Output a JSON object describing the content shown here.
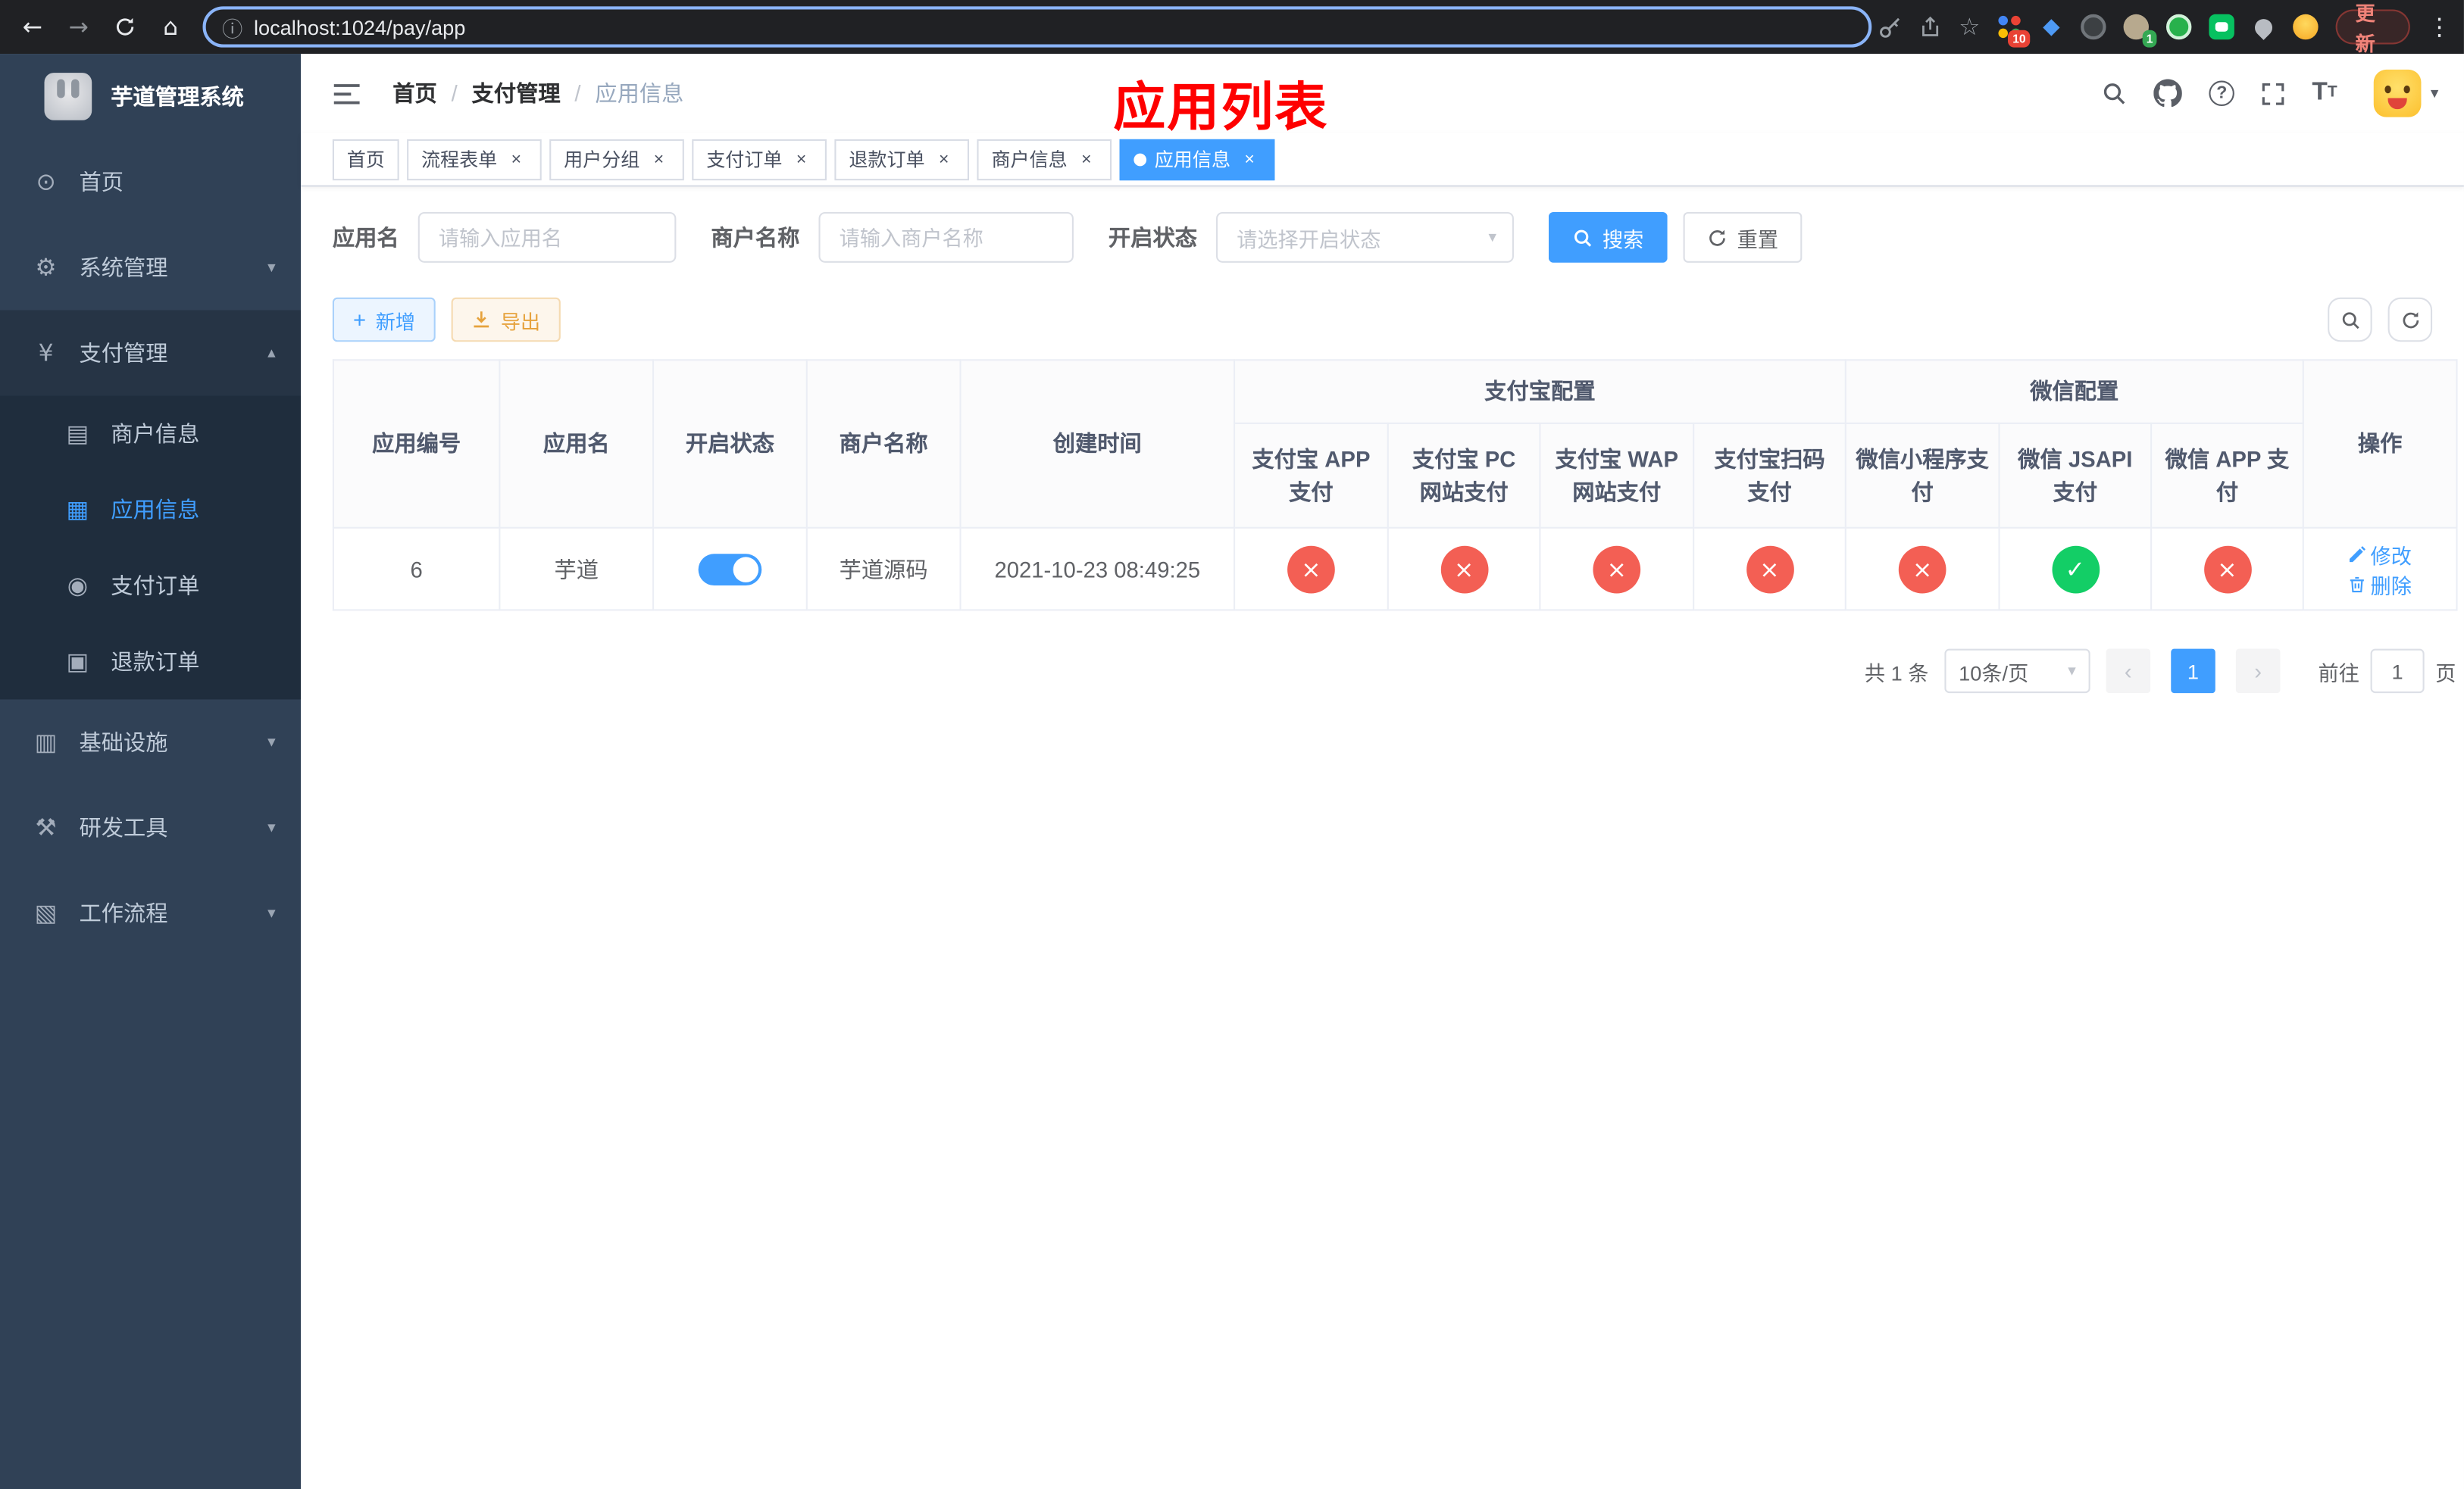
{
  "browser": {
    "url": "localhost:1024/pay/app",
    "update_label": "更新",
    "ext_badge": "10",
    "avatar_badge": "1"
  },
  "sidebar": {
    "app_title": "芋道管理系统",
    "home": "首页",
    "system": "系统管理",
    "payment": "支付管理",
    "merchant_info": "商户信息",
    "app_info": "应用信息",
    "pay_order": "支付订单",
    "refund_order": "退款订单",
    "infrastructure": "基础设施",
    "dev_tools": "研发工具",
    "workflow": "工作流程"
  },
  "header": {
    "breadcrumb": [
      "首页",
      "支付管理",
      "应用信息"
    ],
    "overlay_title": "应用列表"
  },
  "tabs": {
    "items": [
      {
        "label": "首页"
      },
      {
        "label": "流程表单"
      },
      {
        "label": "用户分组"
      },
      {
        "label": "支付订单"
      },
      {
        "label": "退款订单"
      },
      {
        "label": "商户信息"
      },
      {
        "label": "应用信息"
      }
    ]
  },
  "search": {
    "app_name_label": "应用名",
    "app_name_placeholder": "请输入应用名",
    "merchant_label": "商户名称",
    "merchant_placeholder": "请输入商户名称",
    "status_label": "开启状态",
    "status_placeholder": "请选择开启状态",
    "search_button": "搜索",
    "reset_button": "重置"
  },
  "toolbar": {
    "add_button": "新增",
    "export_button": "导出"
  },
  "table": {
    "col_app_id": "应用编号",
    "col_app_name": "应用名",
    "col_status": "开启状态",
    "col_merchant": "商户名称",
    "col_create_time": "创建时间",
    "group_alipay": "支付宝配置",
    "group_wechat": "微信配置",
    "col_alipay_app": "支付宝 APP 支付",
    "col_alipay_pc": "支付宝 PC 网站支付",
    "col_alipay_wap": "支付宝 WAP 网站支付",
    "col_alipay_qr": "支付宝扫码支付",
    "col_wx_mini": "微信小程序支付",
    "col_wx_jsapi": "微信 JSAPI 支付",
    "col_wx_app": "微信 APP 支付",
    "col_actions": "操作",
    "rows": [
      {
        "id": "6",
        "name": "芋道",
        "enabled": true,
        "merchant": "芋道源码",
        "created_at": "2021-10-23 08:49:25",
        "alipay_app": false,
        "alipay_pc": false,
        "alipay_wap": false,
        "alipay_qr": false,
        "wx_mini": false,
        "wx_jsapi": true,
        "wx_app": false,
        "edit_label": "修改",
        "delete_label": "删除"
      }
    ]
  },
  "pagination": {
    "total": "共 1 条",
    "page_size": "10条/页",
    "page": "1",
    "goto_prefix": "前往",
    "goto_value": "1",
    "goto_suffix": "页"
  }
}
